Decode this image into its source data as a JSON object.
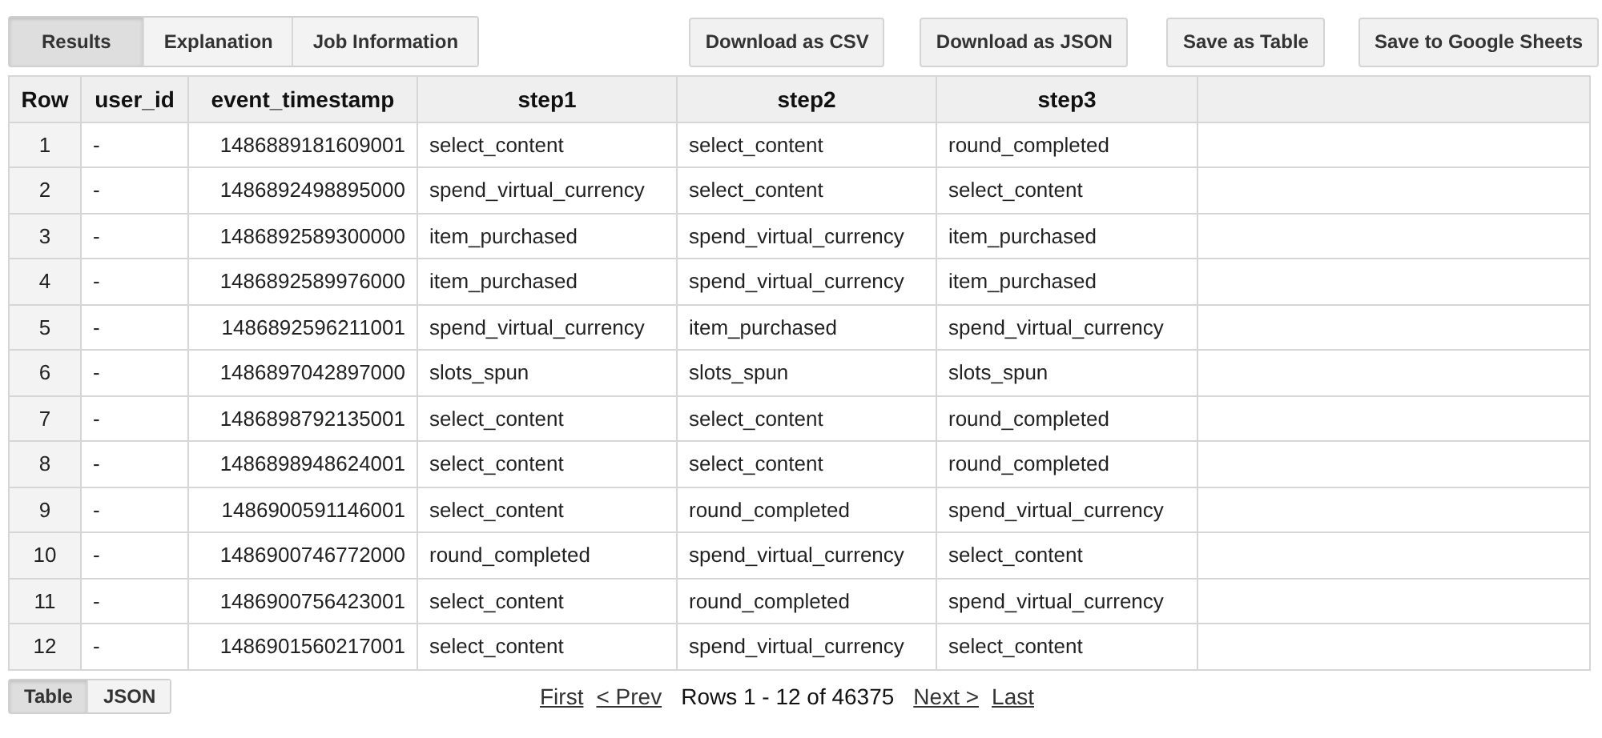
{
  "result_tabs": [
    {
      "label": "Results",
      "selected": true
    },
    {
      "label": "Explanation",
      "selected": false
    },
    {
      "label": "Job Information",
      "selected": false
    }
  ],
  "actions": [
    "Download as CSV",
    "Download as JSON",
    "Save as Table",
    "Save to Google Sheets"
  ],
  "table": {
    "columns": [
      "Row",
      "user_id",
      "event_timestamp",
      "step1",
      "step2",
      "step3"
    ],
    "rows": [
      [
        "1",
        "-",
        "1486889181609001",
        "select_content",
        "select_content",
        "round_completed"
      ],
      [
        "2",
        "-",
        "1486892498895000",
        "spend_virtual_currency",
        "select_content",
        "select_content"
      ],
      [
        "3",
        "-",
        "1486892589300000",
        "item_purchased",
        "spend_virtual_currency",
        "item_purchased"
      ],
      [
        "4",
        "-",
        "1486892589976000",
        "item_purchased",
        "spend_virtual_currency",
        "item_purchased"
      ],
      [
        "5",
        "-",
        "1486892596211001",
        "spend_virtual_currency",
        "item_purchased",
        "spend_virtual_currency"
      ],
      [
        "6",
        "-",
        "1486897042897000",
        "slots_spun",
        "slots_spun",
        "slots_spun"
      ],
      [
        "7",
        "-",
        "1486898792135001",
        "select_content",
        "select_content",
        "round_completed"
      ],
      [
        "8",
        "-",
        "1486898948624001",
        "select_content",
        "select_content",
        "round_completed"
      ],
      [
        "9",
        "-",
        "1486900591146001",
        "select_content",
        "round_completed",
        "spend_virtual_currency"
      ],
      [
        "10",
        "-",
        "1486900746772000",
        "round_completed",
        "spend_virtual_currency",
        "select_content"
      ],
      [
        "11",
        "-",
        "1486900756423001",
        "select_content",
        "round_completed",
        "spend_virtual_currency"
      ],
      [
        "12",
        "-",
        "1486901560217001",
        "select_content",
        "spend_virtual_currency",
        "select_content"
      ]
    ]
  },
  "view_tabs": [
    {
      "label": "Table",
      "selected": true
    },
    {
      "label": "JSON",
      "selected": false
    }
  ],
  "pager": {
    "first": "First",
    "prev": "< Prev",
    "status": "Rows 1 - 12 of 46375",
    "next": "Next >",
    "last": "Last"
  }
}
